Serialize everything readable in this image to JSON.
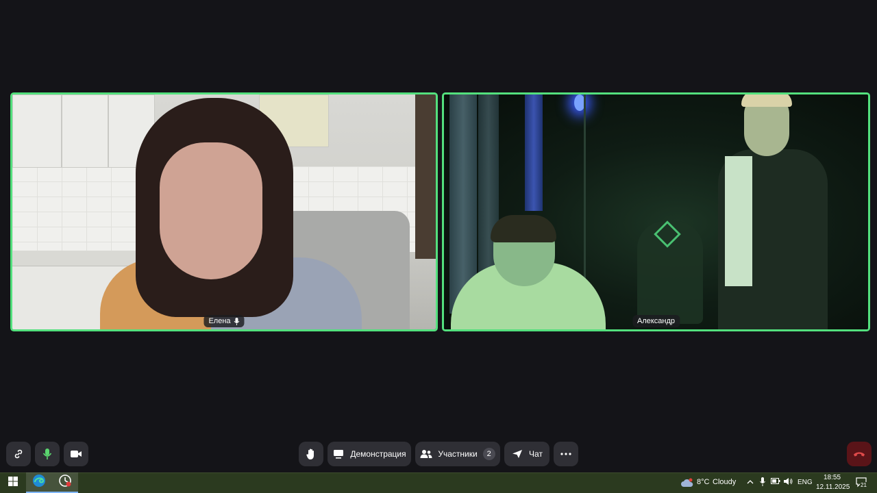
{
  "participants": [
    {
      "name": "Елена",
      "mic_icon": "microphone-icon"
    },
    {
      "name": "Александр"
    }
  ],
  "toolbar": {
    "left": [
      {
        "icon": "link-icon"
      },
      {
        "icon": "microphone-icon",
        "color": "#5bd66f"
      },
      {
        "icon": "camera-icon"
      }
    ],
    "center": {
      "raise_hand_icon": "raise-hand-icon",
      "screen_share_label": "Демонстрация",
      "participants_label": "Участники",
      "participants_count": "2",
      "chat_label": "Чат",
      "more_icon": "more-icon"
    },
    "hangup_icon": "phone-hangup-icon",
    "hangup_color": "#e04a4a"
  },
  "taskbar": {
    "apps": [
      "windows-start-icon",
      "edge-icon",
      "app-icon"
    ],
    "weather": {
      "icon": "cloud-icon",
      "temp": "8°C",
      "condition": "Cloudy"
    },
    "language": "ENG",
    "time": "18:55",
    "date": "12.11.2025",
    "notifications_count": "21"
  },
  "colors": {
    "background": "#141418",
    "active_speaker_border": "#53e07d",
    "toolbar_button": "#2f2f35",
    "taskbar": "#2b3a1f"
  }
}
